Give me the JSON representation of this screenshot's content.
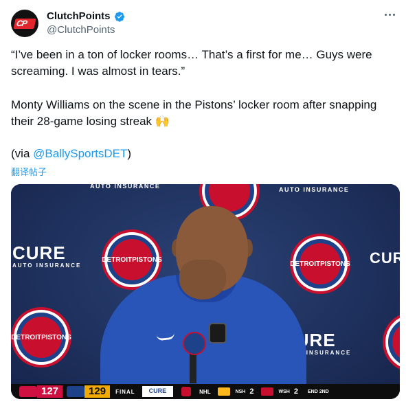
{
  "author": {
    "name": "ClutchPoints",
    "handle": "@ClutchPoints",
    "avatar_text": "CP"
  },
  "tweet": {
    "line1": "“I’ve been in a ton of locker rooms… That’s a first for me… Guys were screaming. I was almost in tears.”",
    "line2_text": "Monty Williams on the scene in the Pistons’ locker room after snapping their 28-game losing streak",
    "line2_emoji": "🙌",
    "via_prefix": "(via ",
    "via_mention": "@BallySportsDET",
    "via_suffix": ")",
    "translate": "翻译帖子"
  },
  "media": {
    "backdrop_words": {
      "cure": "CURE",
      "auto_insurance": "AUTO INSURANCE",
      "pistons_top": "DETROIT",
      "pistons_bottom": "PISTONS"
    },
    "scoreboard": {
      "team1_score": "127",
      "team2_score": "129",
      "status": "FINAL",
      "sponsor": "CURE",
      "league": "NHL",
      "away": "NSH",
      "away_score": "2",
      "home": "WSH",
      "home_score": "2",
      "period": "END 2ND"
    }
  },
  "colors": {
    "accent": "#1d9bf0",
    "pistons_red": "#c8102e",
    "pistons_blue": "#1d428a",
    "raptors_red": "#ce1141"
  }
}
